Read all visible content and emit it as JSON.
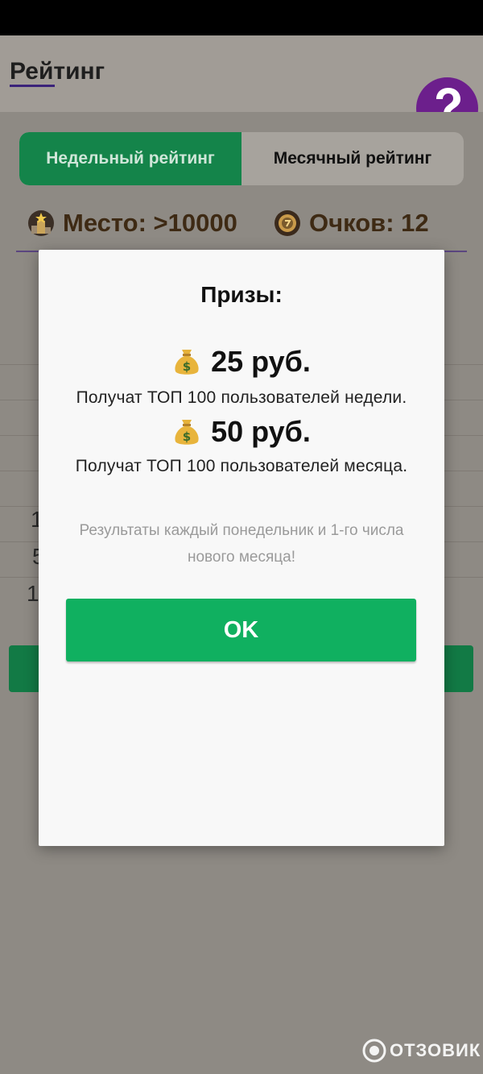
{
  "app": {
    "title": "Рейтинг",
    "help_icon": "question-mark-icon"
  },
  "tabs": {
    "weekly": "Недельный рейтинг",
    "monthly": "Месячный рейтинг"
  },
  "stats": {
    "place": "Место: >10000",
    "points": "Очков: 12"
  },
  "list_partial": {
    "row1": "1",
    "row2": "5",
    "row3": "1"
  },
  "dialog": {
    "title": "Призы:",
    "prize1_amount": "25 руб.",
    "prize1_desc": "Получат ТОП 100 пользователей недели.",
    "prize2_amount": "50 руб.",
    "prize2_desc": "Получат ТОП 100 пользователей месяца.",
    "note": "Результаты каждый понедельник и 1-го числа нового месяца!",
    "ok_label": "OK"
  },
  "watermark": "ОТЗОВИК",
  "colors": {
    "accent_green": "#10b060",
    "tab_green": "#14844a",
    "help_purple": "#6c1f8c"
  }
}
